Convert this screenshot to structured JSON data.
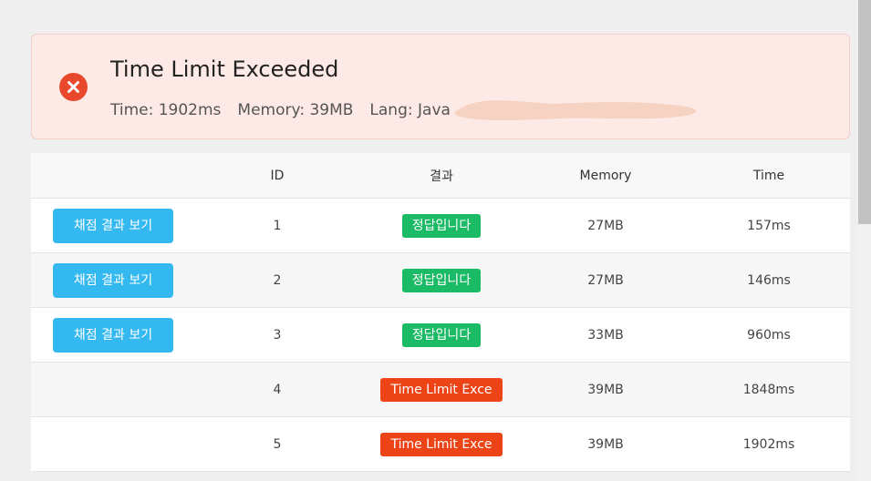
{
  "result": {
    "title": "Time Limit Exceeded",
    "time": "Time: 1902ms",
    "memory": "Memory: 39MB",
    "lang": "Lang: Java",
    "status_icon": "error-x-icon",
    "status_color": "#e8492d"
  },
  "table": {
    "headers": [
      "",
      "ID",
      "결과",
      "Memory",
      "Time"
    ],
    "rows": [
      {
        "button": "채점 결과 보기",
        "id": "1",
        "status": "정답입니다",
        "status_type": "ok",
        "memory": "27MB",
        "time": "157ms"
      },
      {
        "button": "채점 결과 보기",
        "id": "2",
        "status": "정답입니다",
        "status_type": "ok",
        "memory": "27MB",
        "time": "146ms"
      },
      {
        "button": "채점 결과 보기",
        "id": "3",
        "status": "정답입니다",
        "status_type": "ok",
        "memory": "33MB",
        "time": "960ms"
      },
      {
        "button": "",
        "id": "4",
        "status": "Time Limit Exce",
        "status_type": "tle",
        "memory": "39MB",
        "time": "1848ms"
      },
      {
        "button": "",
        "id": "5",
        "status": "Time Limit Exce",
        "status_type": "tle",
        "memory": "39MB",
        "time": "1902ms"
      }
    ]
  },
  "colors": {
    "accepted": "#1bba64",
    "time_limit": "#ec4417",
    "button": "#33b8f0",
    "banner_bg": "#fde9e6"
  }
}
